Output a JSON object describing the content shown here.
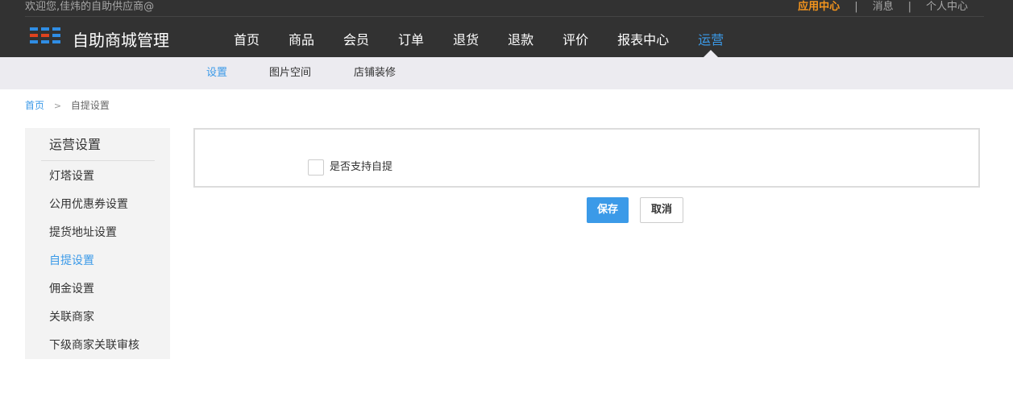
{
  "header": {
    "welcome": "欢迎您,佳炜的自助供应商@",
    "links": {
      "app_center": "应用中心",
      "sep": "|",
      "messages": "消息",
      "profile": "个人中心"
    },
    "brand": "自助商城管理",
    "colors": {
      "accent": "#3b9ae8",
      "highlight": "#f5951d",
      "bar": "#323232"
    }
  },
  "main_nav": [
    "首页",
    "商品",
    "会员",
    "订单",
    "退货",
    "退款",
    "评价",
    "报表中心",
    "运营"
  ],
  "sub_nav": [
    "设置",
    "图片空间",
    "店铺装修"
  ],
  "breadcrumb": {
    "home": "首页",
    "sep": ">",
    "current": "自提设置"
  },
  "sidebar": {
    "title": "运营设置",
    "items": [
      "灯塔设置",
      "公用优惠券设置",
      "提货地址设置",
      "自提设置",
      "佣金设置",
      "关联商家",
      "下级商家关联审核"
    ]
  },
  "form": {
    "support_pickup_label": "是否支持自提",
    "checked": false
  },
  "actions": {
    "save": "保存",
    "cancel": "取消"
  }
}
